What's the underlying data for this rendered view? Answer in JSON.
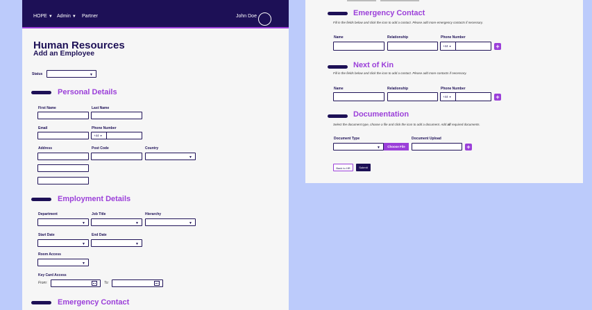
{
  "nav": {
    "hope": "HOPE",
    "admin": "Admin",
    "partner": "Partner",
    "user": "John Doe"
  },
  "header": {
    "title": "Human Resources",
    "subtitle": "Add an Employee"
  },
  "status_label": "Status",
  "personal": {
    "title": "Personal Details",
    "first_name": "First Name",
    "last_name": "Last Name",
    "email": "Email",
    "phone": "Phone Number",
    "phone_code": "+44",
    "address": "Address",
    "post_code": "Post Code",
    "country": "Country"
  },
  "employment": {
    "title": "Employment Details",
    "department": "Department",
    "job_title": "Job Title",
    "hierarchy": "Hierarchy",
    "start_date": "Start Date",
    "end_date": "End Date",
    "room_access": "Room Access",
    "key_card": "Key Card Access",
    "from": "From:",
    "to": "To:"
  },
  "emergency": {
    "title": "Emergency Contact",
    "hint": "Fill in the fields below and click the icon to add a contact. Please add more emergency contacts if necessary.",
    "name": "Name",
    "relationship": "Relationship",
    "phone": "Phone Number",
    "phone_code": "+44"
  },
  "kin": {
    "title": "Next of Kin",
    "hint": "Fill in the fields below and click the icon to add a contact. Please add more contacts if necessary.",
    "name": "Name",
    "relationship": "Relationship",
    "phone": "Phone Number",
    "phone_code": "+44"
  },
  "documentation": {
    "title": "Documentation",
    "hint_pre": "Select the document type, choose a file and click the icon to add a document. Add ",
    "hint_bold": "all",
    "hint_post": " required documents.",
    "doc_type": "Document Type",
    "doc_upload": "Document Upload",
    "choose_file": "Choose File"
  },
  "buttons": {
    "back": "Back to HR",
    "submit": "Submit"
  }
}
